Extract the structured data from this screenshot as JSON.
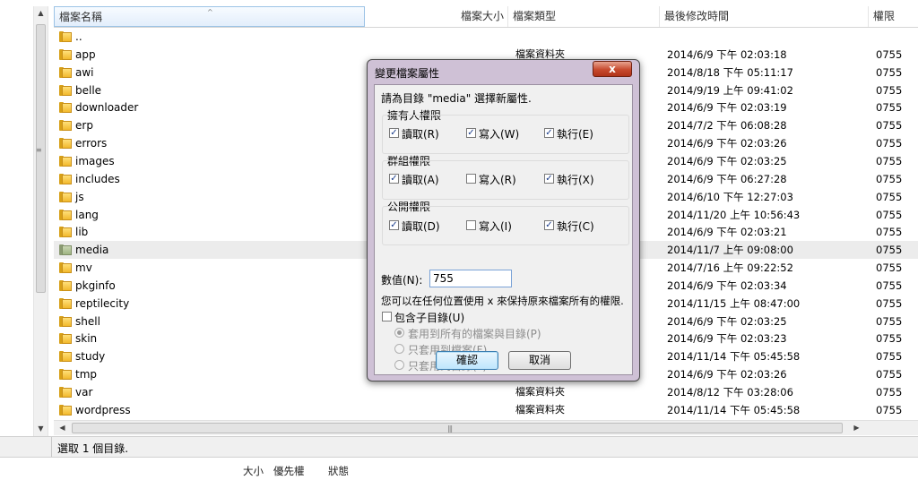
{
  "file_list": {
    "columns": {
      "name": "檔案名稱",
      "size": "檔案大小",
      "type": "檔案類型",
      "modified": "最後修改時間",
      "permissions": "權限"
    },
    "rows": [
      {
        "name": "..",
        "type": "",
        "modified": "",
        "perm": ""
      },
      {
        "name": "app",
        "type": "檔案資料夾",
        "modified": "2014/6/9 下午 02:03:18",
        "perm": "0755"
      },
      {
        "name": "awi",
        "type": "檔案資料夾",
        "modified": "2014/8/18 下午 05:11:17",
        "perm": "0755"
      },
      {
        "name": "belle",
        "type": "",
        "modified": "2014/9/19 上午 09:41:02",
        "perm": "0755"
      },
      {
        "name": "downloader",
        "type": "",
        "modified": "2014/6/9 下午 02:03:19",
        "perm": "0755"
      },
      {
        "name": "erp",
        "type": "",
        "modified": "2014/7/2 下午 06:08:28",
        "perm": "0755"
      },
      {
        "name": "errors",
        "type": "",
        "modified": "2014/6/9 下午 02:03:26",
        "perm": "0755"
      },
      {
        "name": "images",
        "type": "",
        "modified": "2014/6/9 下午 02:03:25",
        "perm": "0755"
      },
      {
        "name": "includes",
        "type": "",
        "modified": "2014/6/9 下午 06:27:28",
        "perm": "0755"
      },
      {
        "name": "js",
        "type": "",
        "modified": "2014/6/10 下午 12:27:03",
        "perm": "0755"
      },
      {
        "name": "lang",
        "type": "",
        "modified": "2014/11/20 上午 10:56:43",
        "perm": "0755"
      },
      {
        "name": "lib",
        "type": "",
        "modified": "2014/6/9 下午 02:03:21",
        "perm": "0755"
      },
      {
        "name": "media",
        "type": "",
        "modified": "2014/11/7 上午 09:08:00",
        "perm": "0755",
        "selected": true
      },
      {
        "name": "mv",
        "type": "",
        "modified": "2014/7/16 上午 09:22:52",
        "perm": "0755"
      },
      {
        "name": "pkginfo",
        "type": "",
        "modified": "2014/6/9 下午 02:03:34",
        "perm": "0755"
      },
      {
        "name": "reptilecity",
        "type": "",
        "modified": "2014/11/15 上午 08:47:00",
        "perm": "0755"
      },
      {
        "name": "shell",
        "type": "",
        "modified": "2014/6/9 下午 02:03:25",
        "perm": "0755"
      },
      {
        "name": "skin",
        "type": "",
        "modified": "2014/6/9 下午 02:03:23",
        "perm": "0755"
      },
      {
        "name": "study",
        "type": "",
        "modified": "2014/11/14 下午 05:45:58",
        "perm": "0755"
      },
      {
        "name": "tmp",
        "type": "",
        "modified": "2014/6/9 下午 02:03:26",
        "perm": "0755"
      },
      {
        "name": "var",
        "type": "檔案資料夾",
        "modified": "2014/8/12 下午 03:28:06",
        "perm": "0755"
      },
      {
        "name": "wordpress",
        "type": "檔案資料夾",
        "modified": "2014/11/14 下午 05:45:58",
        "perm": "0755"
      }
    ]
  },
  "status": {
    "text": "選取 1 個目錄."
  },
  "queue_header": {
    "size": "大小",
    "priority": "優先權",
    "status": "狀態"
  },
  "dialog": {
    "title": "變更檔案屬性",
    "close_label": "x",
    "description": "請為目錄 \"media\" 選擇新屬性.",
    "owner": {
      "label": "擁有人權限",
      "read": "讀取(R)",
      "write": "寫入(W)",
      "exec": "執行(E)",
      "read_checked": true,
      "write_checked": true,
      "exec_checked": true
    },
    "group": {
      "label": "群組權限",
      "read": "讀取(A)",
      "write": "寫入(R)",
      "exec": "執行(X)",
      "read_checked": true,
      "write_checked": false,
      "exec_checked": true
    },
    "public": {
      "label": "公開權限",
      "read": "讀取(D)",
      "write": "寫入(I)",
      "exec": "執行(C)",
      "read_checked": true,
      "write_checked": false,
      "exec_checked": true
    },
    "numeric_label": "數值(N):",
    "numeric_value": "755",
    "hint": "您可以在任何位置使用 x 來保持原來檔案所有的權限.",
    "recurse_label": "包含子目錄(U)",
    "apply_all": "套用到所有的檔案與目錄(P)",
    "apply_files": "只套用到檔案(F)",
    "apply_dirs": "只套用到目錄(L)",
    "ok_label": "確認",
    "cancel_label": "取消"
  },
  "colors": {
    "selected_row": "#ececec",
    "folder": "#f2b92d",
    "dialog_frame": "#cfc1d6",
    "close_button": "#c74a2e"
  }
}
